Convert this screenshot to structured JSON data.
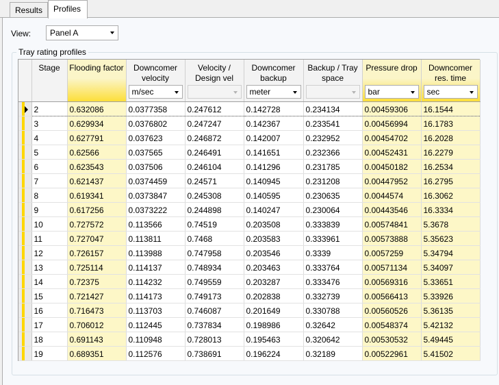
{
  "tabs": [
    {
      "label": "Results",
      "active": false
    },
    {
      "label": "Profiles",
      "active": true
    }
  ],
  "view": {
    "label": "View:",
    "value": "Panel A"
  },
  "group_title": "Tray rating profiles",
  "columns": {
    "stage": "Stage",
    "flooding": "Flooding factor",
    "dc_velocity": "Downcomer velocity",
    "vel_design": "Velocity / Design vel",
    "dc_backup": "Downcomer backup",
    "backup_tray": "Backup / Tray space",
    "pressure_drop": "Pressure drop",
    "dc_res_time": "Downcomer res. time"
  },
  "units": {
    "dc_velocity": "m/sec",
    "vel_design": "",
    "dc_backup": "meter",
    "backup_tray": "",
    "pressure_drop": "bar",
    "dc_res_time": "sec"
  },
  "highlight_color": "#fcde3a",
  "rows": [
    [
      "2",
      "0.632086",
      "0.0377358",
      "0.247612",
      "0.142728",
      "0.234134",
      "0.00459306",
      "16.1544"
    ],
    [
      "3",
      "0.629934",
      "0.0376802",
      "0.247247",
      "0.142367",
      "0.233541",
      "0.00456994",
      "16.1783"
    ],
    [
      "4",
      "0.627791",
      "0.037623",
      "0.246872",
      "0.142007",
      "0.232952",
      "0.00454702",
      "16.2028"
    ],
    [
      "5",
      "0.62566",
      "0.037565",
      "0.246491",
      "0.141651",
      "0.232366",
      "0.00452431",
      "16.2279"
    ],
    [
      "6",
      "0.623543",
      "0.037506",
      "0.246104",
      "0.141296",
      "0.231785",
      "0.00450182",
      "16.2534"
    ],
    [
      "7",
      "0.621437",
      "0.0374459",
      "0.24571",
      "0.140945",
      "0.231208",
      "0.00447952",
      "16.2795"
    ],
    [
      "8",
      "0.619341",
      "0.0373847",
      "0.245308",
      "0.140595",
      "0.230635",
      "0.0044574",
      "16.3062"
    ],
    [
      "9",
      "0.617256",
      "0.0373222",
      "0.244898",
      "0.140247",
      "0.230064",
      "0.00443546",
      "16.3334"
    ],
    [
      "10",
      "0.727572",
      "0.113566",
      "0.74519",
      "0.203508",
      "0.333839",
      "0.00574841",
      "5.3678"
    ],
    [
      "11",
      "0.727047",
      "0.113811",
      "0.7468",
      "0.203583",
      "0.333961",
      "0.00573888",
      "5.35623"
    ],
    [
      "12",
      "0.726157",
      "0.113988",
      "0.747958",
      "0.203546",
      "0.3339",
      "0.0057259",
      "5.34794"
    ],
    [
      "13",
      "0.725114",
      "0.114137",
      "0.748934",
      "0.203463",
      "0.333764",
      "0.00571134",
      "5.34097"
    ],
    [
      "14",
      "0.72375",
      "0.114232",
      "0.749559",
      "0.203287",
      "0.333476",
      "0.00569316",
      "5.33651"
    ],
    [
      "15",
      "0.721427",
      "0.114173",
      "0.749173",
      "0.202838",
      "0.332739",
      "0.00566413",
      "5.33926"
    ],
    [
      "16",
      "0.716473",
      "0.113703",
      "0.746087",
      "0.201649",
      "0.330788",
      "0.00560526",
      "5.36135"
    ],
    [
      "17",
      "0.706012",
      "0.112445",
      "0.737834",
      "0.198986",
      "0.32642",
      "0.00548374",
      "5.42132"
    ],
    [
      "18",
      "0.691143",
      "0.110948",
      "0.728013",
      "0.195463",
      "0.320642",
      "0.00530532",
      "5.49445"
    ],
    [
      "19",
      "0.689351",
      "0.112576",
      "0.738691",
      "0.196224",
      "0.32189",
      "0.00522961",
      "5.41502"
    ]
  ]
}
